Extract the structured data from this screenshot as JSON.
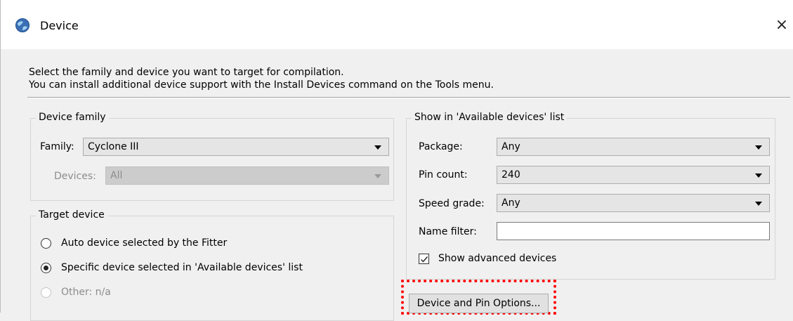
{
  "window": {
    "title": "Device",
    "close_glyph": "×",
    "app_icon": "globe-icon"
  },
  "instructions": {
    "line1": "Select the family and device you want to target for compilation.",
    "line2": "You can install additional device support with the Install Devices command on the Tools menu."
  },
  "device_family": {
    "legend": "Device family",
    "family_label": "Family:",
    "family_value": "Cyclone III",
    "devices_label": "Devices:",
    "devices_value": "All"
  },
  "target_device": {
    "legend": "Target device",
    "options": [
      {
        "label": "Auto device selected by the Fitter",
        "checked": false,
        "enabled": true
      },
      {
        "label": "Specific device selected in 'Available devices' list",
        "checked": true,
        "enabled": true
      },
      {
        "label": "Other:  n/a",
        "checked": false,
        "enabled": false
      }
    ]
  },
  "show_list": {
    "legend": "Show in 'Available devices' list",
    "package_label": "Package:",
    "package_value": "Any",
    "pin_count_label": "Pin count:",
    "pin_count_value": "240",
    "speed_grade_label": "Speed grade:",
    "speed_grade_value": "Any",
    "name_filter_label": "Name filter:",
    "name_filter_value": "",
    "show_advanced_label": "Show advanced devices",
    "show_advanced_checked": true
  },
  "buttons": {
    "device_pin_options": "Device and Pin Options..."
  },
  "colors": {
    "highlight": "#ff0000",
    "window_bg": "#f0f0f0",
    "titlebar_bg": "#ffffff"
  }
}
